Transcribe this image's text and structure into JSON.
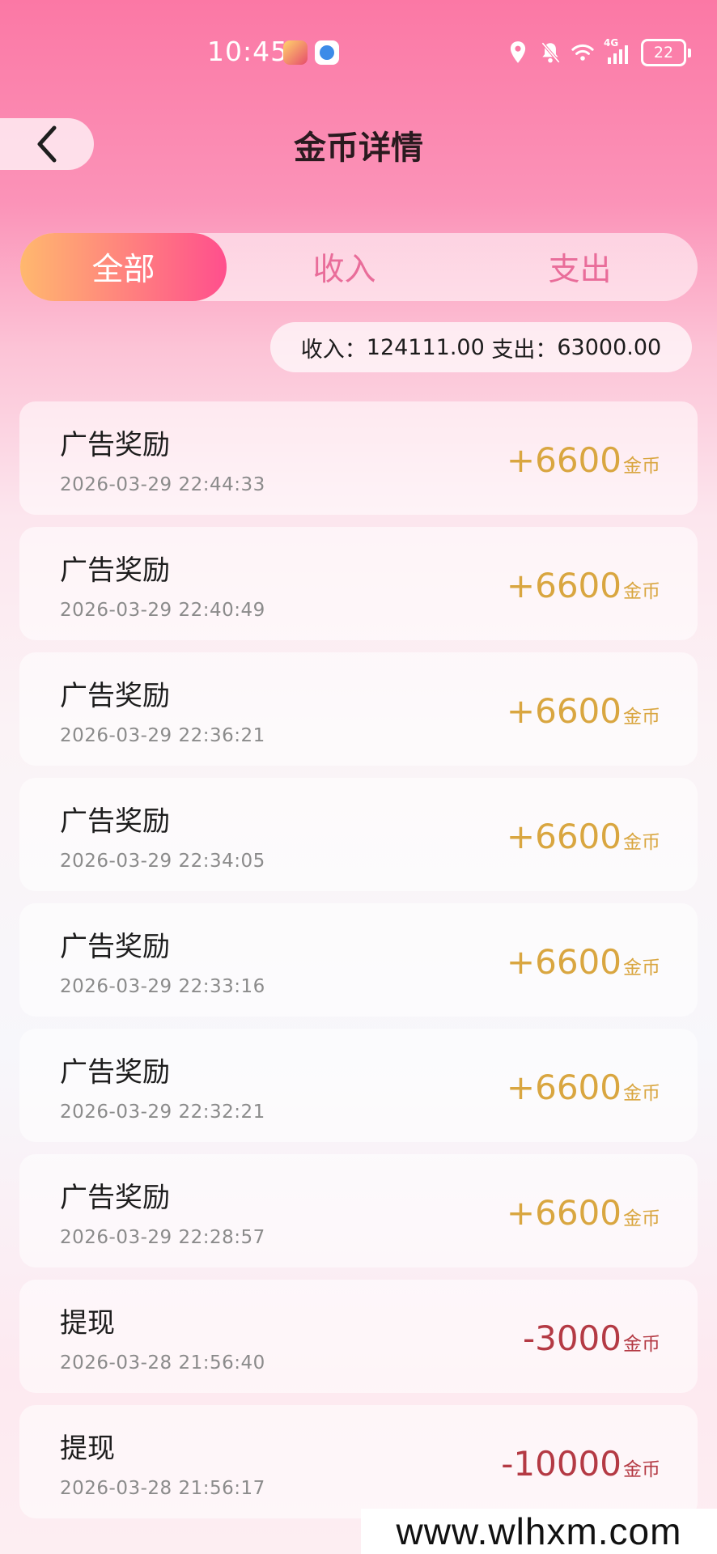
{
  "status_bar": {
    "time": "10:45",
    "network": "4G",
    "battery": "22",
    "icons": [
      "location-icon",
      "bell-off-icon",
      "wifi-icon",
      "cellular-signal-icon"
    ]
  },
  "header": {
    "title": "金币详情",
    "back_icon": "chevron-left-icon"
  },
  "tabs": [
    {
      "label": "全部",
      "active": true
    },
    {
      "label": "收入",
      "active": false
    },
    {
      "label": "支出",
      "active": false
    }
  ],
  "summary": {
    "income_label": "收入：",
    "income_value": "124111.00",
    "expense_label": "支出：",
    "expense_value": "63000.00"
  },
  "records": [
    {
      "title": "广告奖励",
      "time": "2026-03-29 22:44:33",
      "amount": "+6600",
      "unit": "金币",
      "type": "income"
    },
    {
      "title": "广告奖励",
      "time": "2026-03-29 22:40:49",
      "amount": "+6600",
      "unit": "金币",
      "type": "income"
    },
    {
      "title": "广告奖励",
      "time": "2026-03-29 22:36:21",
      "amount": "+6600",
      "unit": "金币",
      "type": "income"
    },
    {
      "title": "广告奖励",
      "time": "2026-03-29 22:34:05",
      "amount": "+6600",
      "unit": "金币",
      "type": "income"
    },
    {
      "title": "广告奖励",
      "time": "2026-03-29 22:33:16",
      "amount": "+6600",
      "unit": "金币",
      "type": "income"
    },
    {
      "title": "广告奖励",
      "time": "2026-03-29 22:32:21",
      "amount": "+6600",
      "unit": "金币",
      "type": "income"
    },
    {
      "title": "广告奖励",
      "time": "2026-03-29 22:28:57",
      "amount": "+6600",
      "unit": "金币",
      "type": "income"
    },
    {
      "title": "提现",
      "time": "2026-03-28 21:56:40",
      "amount": "-3000",
      "unit": "金币",
      "type": "expense"
    },
    {
      "title": "提现",
      "time": "2026-03-28 21:56:17",
      "amount": "-10000",
      "unit": "金币",
      "type": "expense"
    }
  ],
  "watermark": "www.wlhxm.com",
  "colors": {
    "accent_gradient_start": "#ffb86e",
    "accent_gradient_end": "#ff4f8d",
    "income_color": "#d9a640",
    "expense_color": "#b43a44"
  }
}
